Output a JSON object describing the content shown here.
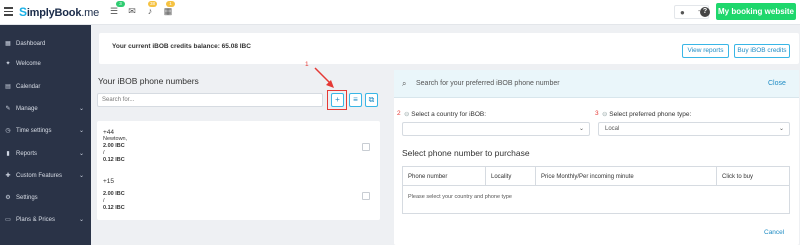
{
  "header": {
    "logo_s": "S",
    "logo_main": "implyBook",
    "logo_suffix": ".me",
    "badges": [
      "3",
      "38",
      "1"
    ],
    "my_booking_label": "My booking website"
  },
  "sidebar": {
    "items": [
      {
        "label": "Dashboard",
        "icon": "dashboard-icon",
        "glyph": "▦",
        "chevron": false
      },
      {
        "label": "Welcome",
        "icon": "lightbulb-icon",
        "glyph": "✦",
        "chevron": false
      },
      {
        "label": "Calendar",
        "icon": "calendar-icon",
        "glyph": "▤",
        "chevron": false
      },
      {
        "label": "Manage",
        "icon": "pencil-icon",
        "glyph": "✎",
        "chevron": true
      },
      {
        "label": "Time settings",
        "icon": "clock-icon",
        "glyph": "◷",
        "chevron": true
      },
      {
        "label": "Reports",
        "icon": "bar-chart-icon",
        "glyph": "▮",
        "chevron": true
      },
      {
        "label": "Custom Features",
        "icon": "puzzle-icon",
        "glyph": "✚",
        "chevron": true
      },
      {
        "label": "Settings",
        "icon": "gear-icon",
        "glyph": "⚙",
        "chevron": false
      },
      {
        "label": "Plans & Prices",
        "icon": "card-icon",
        "glyph": "▭",
        "chevron": true
      }
    ]
  },
  "credits": {
    "balance_text": "Your current iBOB credits balance: 65.08 IBC",
    "view_reports_label": "View reports",
    "buy_label": "Buy iBOB credits"
  },
  "phones": {
    "title": "Your iBOB phone numbers",
    "search_placeholder": "Search for...",
    "list": [
      {
        "number": "+44",
        "locality": "Newtown,",
        "price_monthly": "2.00 IBC",
        "sep": "/",
        "price_minute": "0.12 IBC"
      },
      {
        "number": "+15",
        "locality": "",
        "price_monthly": "2.00 IBC",
        "sep": "/",
        "price_minute": "0.12 IBC"
      }
    ]
  },
  "markers": {
    "one": "1",
    "two": "2",
    "three": "3"
  },
  "search_panel": {
    "title": "Search for your preferred iBOB phone number",
    "close_label": "Close",
    "country_label": "Select a country for iBOB:",
    "country_value": "",
    "type_label": "Select preferred phone type:",
    "type_value": "Local",
    "purchase_title": "Select phone number to purchase",
    "columns": [
      "Phone number",
      "Locality",
      "Price Monthly/Per incoming minute",
      "Click to buy"
    ],
    "empty_message": "Please select your country and phone type",
    "cancel_label": "Cancel"
  },
  "colors": {
    "sidebar_bg": "#2a3347",
    "accent_green": "#1ed76c",
    "accent_blue": "#39b6e6",
    "highlight_red": "#e53935"
  }
}
